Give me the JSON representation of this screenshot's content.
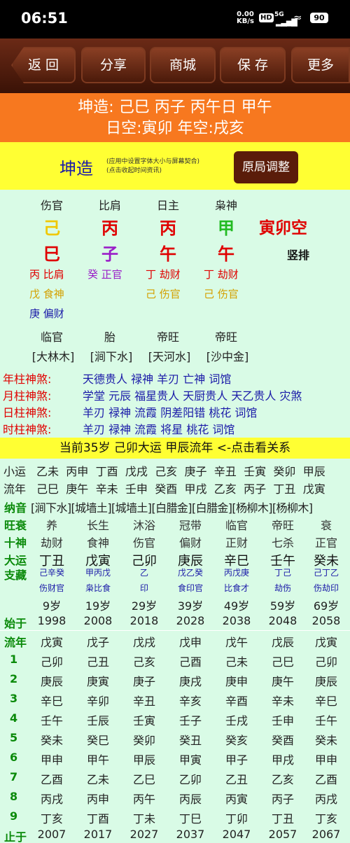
{
  "status": {
    "time": "06:51",
    "net_speed": "0.00",
    "net_unit": "KB/s",
    "hd": "HD",
    "signal": "5G",
    "battery": "90"
  },
  "toolbar": {
    "back": "返 回",
    "share": "分享",
    "mall": "商城",
    "save": "保 存",
    "more": "更多"
  },
  "header": {
    "line1": "坤造: 己巳 丙子 丙午日 甲午",
    "line2": "日空:寅卯 年空:戌亥"
  },
  "info": {
    "title": "坤造",
    "note1": "(应用中设置字体大小与屏幕契合)",
    "note2": "(点击收起时间资讯)",
    "adjust": "原局调整"
  },
  "pillars": {
    "gods": [
      "伤官",
      "比肩",
      "日主",
      "枭神"
    ],
    "stems": [
      "己",
      "丙",
      "丙",
      "甲"
    ],
    "stem_colors": [
      "#f0c800",
      "#e00000",
      "#e00000",
      "#22bb22"
    ],
    "branches": [
      "巳",
      "子",
      "午",
      "午"
    ],
    "branch_colors": [
      "#e00000",
      "#9a1ec8",
      "#e00000",
      "#e00000"
    ],
    "void": "寅卯空",
    "vertical": "竖排",
    "hidden": [
      [
        {
          "t": "丙 比肩",
          "c": "#e00000"
        },
        {
          "t": "戊 食神",
          "c": "#d4a000"
        },
        {
          "t": "庚 偏财",
          "c": "#1a1aa8"
        }
      ],
      [
        {
          "t": "癸 正官",
          "c": "#9a1ec8"
        }
      ],
      [
        {
          "t": "丁 劫财",
          "c": "#e00000"
        },
        {
          "t": "己 伤官",
          "c": "#d4a000"
        }
      ],
      [
        {
          "t": "丁 劫财",
          "c": "#e00000"
        },
        {
          "t": "己 伤官",
          "c": "#d4a000"
        }
      ]
    ],
    "stages": [
      "临官",
      "胎",
      "帝旺",
      "帝旺"
    ],
    "nayin": [
      "[大林木]",
      "[涧下水]",
      "[天河水]",
      "[沙中金]"
    ]
  },
  "shensha": [
    {
      "label": "年柱神煞:",
      "value": "天德贵人 禄神 羊刃 亡神 词馆"
    },
    {
      "label": "月柱神煞:",
      "value": "学堂 元辰 福星贵人 天厨贵人 天乙贵人 灾煞"
    },
    {
      "label": "日柱神煞:",
      "value": "羊刃 禄神 流霞 阴差阳错 桃花 词馆"
    },
    {
      "label": "时柱神煞:",
      "value": "羊刃 禄神 流霞 将星 桃花 词馆"
    }
  ],
  "current": "当前35岁 己卯大运 甲辰流年   <-点击看关系",
  "xiaoyun": {
    "label": "小运",
    "values": [
      "乙未",
      "丙申",
      "丁酉",
      "戊戌",
      "己亥",
      "庚子",
      "辛丑",
      "壬寅",
      "癸卯",
      "甲辰"
    ]
  },
  "liunian_row": {
    "label": "流年",
    "values": [
      "己巳",
      "庚午",
      "辛未",
      "壬申",
      "癸酉",
      "甲戌",
      "乙亥",
      "丙子",
      "丁丑",
      "戊寅"
    ]
  },
  "dayun": {
    "nayin_label": "纳音",
    "nayin": "[涧下水][城墙土][城墙土][白腊金][白腊金][杨柳木][杨柳木]",
    "rows": [
      {
        "label": "旺衰",
        "values": [
          "养",
          "长生",
          "沐浴",
          "冠带",
          "临官",
          "帝旺",
          "衰"
        ]
      },
      {
        "label": "十神",
        "values": [
          "劫财",
          "食神",
          "伤官",
          "偏财",
          "正财",
          "七杀",
          "正官"
        ]
      },
      {
        "label": "大运",
        "values": [
          "丁丑",
          "戊寅",
          "己卯",
          "庚辰",
          "辛巳",
          "壬午",
          "癸未"
        ]
      }
    ],
    "zhicang_label": "支藏",
    "zhicang_top": [
      "己辛癸",
      "甲丙戊",
      "乙",
      "戊乙癸",
      "丙戊庚",
      "丁己",
      "己丁乙"
    ],
    "zhicang_bot": [
      "伤财官",
      "枭比食",
      "印",
      "食印官",
      "比食才",
      "劫伤",
      "伤劫印"
    ],
    "ages": [
      "9岁",
      "19岁",
      "29岁",
      "39岁",
      "49岁",
      "59岁",
      "69岁"
    ],
    "start_label": "始于",
    "start_years": [
      "1998",
      "2008",
      "2018",
      "2028",
      "2038",
      "2048",
      "2058"
    ],
    "ln_label": "流年",
    "ln_header": [
      "戊寅",
      "戊子",
      "戊戌",
      "戊申",
      "戊午",
      "戊辰",
      "戊寅"
    ],
    "years": [
      {
        "n": "1",
        "v": [
          "己卯",
          "己丑",
          "己亥",
          "己酉",
          "己未",
          "己巳",
          "己卯"
        ]
      },
      {
        "n": "2",
        "v": [
          "庚辰",
          "庚寅",
          "庚子",
          "庚戌",
          "庚申",
          "庚午",
          "庚辰"
        ]
      },
      {
        "n": "3",
        "v": [
          "辛巳",
          "辛卯",
          "辛丑",
          "辛亥",
          "辛酉",
          "辛未",
          "辛巳"
        ]
      },
      {
        "n": "4",
        "v": [
          "壬午",
          "壬辰",
          "壬寅",
          "壬子",
          "壬戌",
          "壬申",
          "壬午"
        ]
      },
      {
        "n": "5",
        "v": [
          "癸未",
          "癸巳",
          "癸卯",
          "癸丑",
          "癸亥",
          "癸酉",
          "癸未"
        ]
      },
      {
        "n": "6",
        "v": [
          "甲申",
          "甲午",
          "甲辰",
          "甲寅",
          "甲子",
          "甲戌",
          "甲申"
        ]
      },
      {
        "n": "7",
        "v": [
          "乙酉",
          "乙未",
          "乙巳",
          "乙卯",
          "乙丑",
          "乙亥",
          "乙酉"
        ]
      },
      {
        "n": "8",
        "v": [
          "丙戌",
          "丙申",
          "丙午",
          "丙辰",
          "丙寅",
          "丙子",
          "丙戌"
        ]
      },
      {
        "n": "9",
        "v": [
          "丁亥",
          "丁酉",
          "丁未",
          "丁巳",
          "丁卯",
          "丁丑",
          "丁亥"
        ]
      }
    ],
    "end_label": "止于",
    "end_years": [
      "2007",
      "2017",
      "2027",
      "2037",
      "2047",
      "2057",
      "2067"
    ]
  }
}
